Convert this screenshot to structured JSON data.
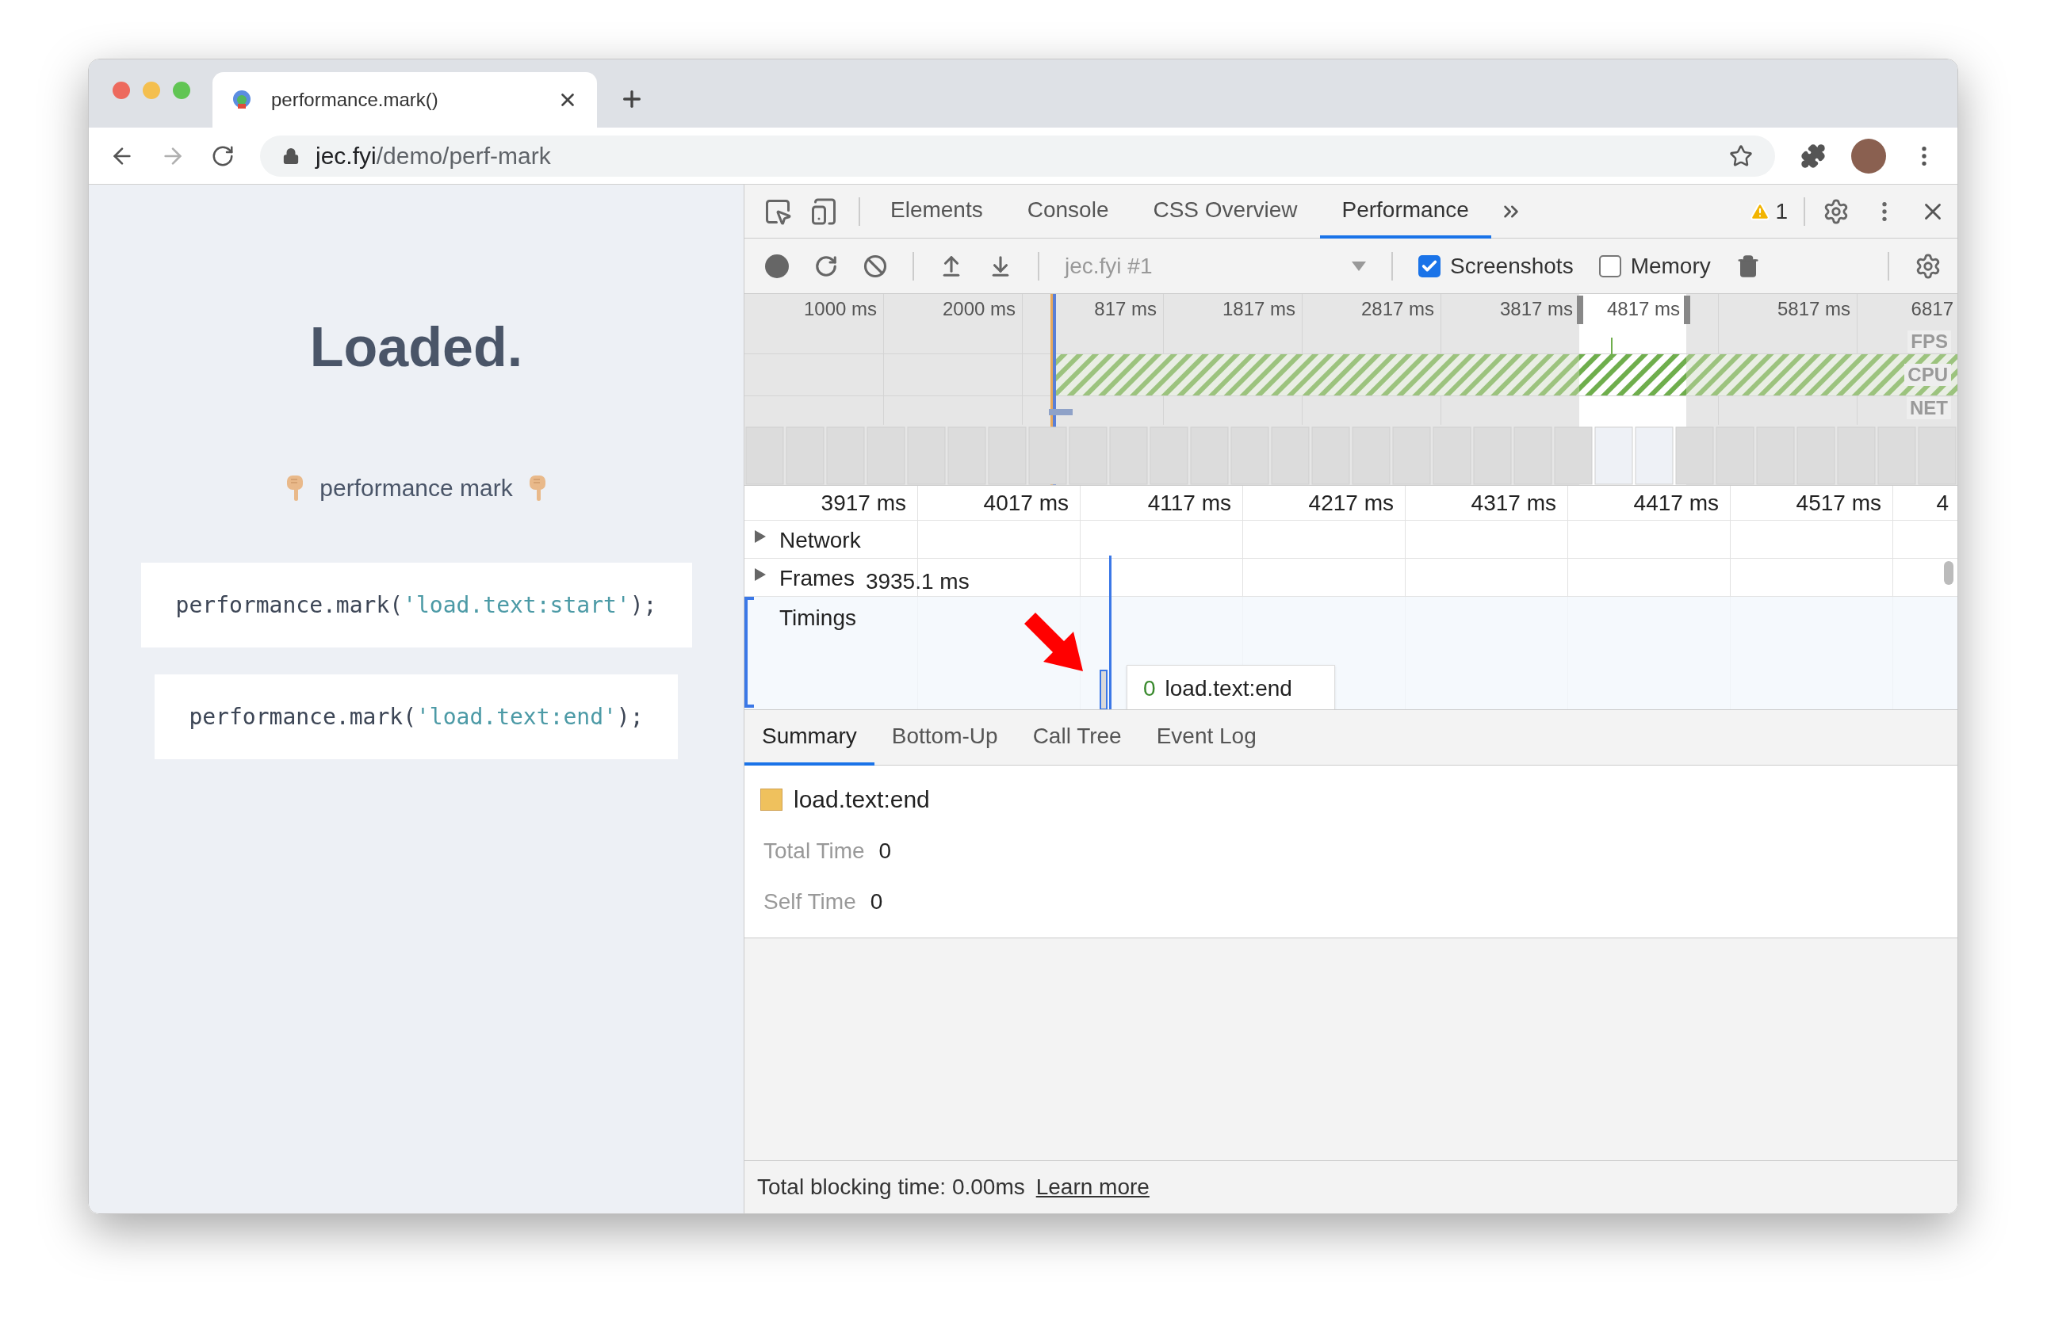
{
  "browser": {
    "tab_title": "performance.mark()",
    "url_host": "jec.fyi",
    "url_path": "/demo/perf-mark"
  },
  "page": {
    "heading": "Loaded.",
    "subheading": "performance mark",
    "code_blocks": [
      {
        "call": "performance.mark(",
        "arg": "'load.text:start'",
        "close": ");"
      },
      {
        "call": "performance.mark(",
        "arg": "'load.text:end'",
        "close": ");"
      }
    ]
  },
  "devtools": {
    "tabs": [
      {
        "label": "Elements",
        "selected": false
      },
      {
        "label": "Console",
        "selected": false
      },
      {
        "label": "CSS Overview",
        "selected": false
      },
      {
        "label": "Performance",
        "selected": true
      }
    ],
    "warning_count": "1",
    "recording_select": "jec.fyi #1",
    "options": [
      {
        "label": "Screenshots",
        "checked": true
      },
      {
        "label": "Memory",
        "checked": false
      }
    ],
    "overview": {
      "ticks": [
        "1000 ms",
        "2000 ms",
        "817 ms",
        "1817 ms",
        "2817 ms",
        "3817 ms",
        "4817 ms",
        "5817 ms",
        "6817"
      ],
      "track_labels": [
        "FPS",
        "CPU",
        "NET"
      ]
    },
    "timeline": {
      "ticks": [
        "3917 ms",
        "4017 ms",
        "4117 ms",
        "4217 ms",
        "4317 ms",
        "4417 ms",
        "4517 ms",
        "4"
      ],
      "tracks": [
        {
          "label": "Network",
          "expandable": true,
          "selected": false
        },
        {
          "label": "Frames",
          "expandable": true,
          "selected": false,
          "value": "3935.1 ms"
        },
        {
          "label": "Timings",
          "expandable": false,
          "selected": true
        }
      ],
      "tooltip": {
        "value": "0",
        "label": "load.text:end"
      }
    },
    "detail_tabs": [
      {
        "label": "Summary",
        "selected": true
      },
      {
        "label": "Bottom-Up",
        "selected": false
      },
      {
        "label": "Call Tree",
        "selected": false
      },
      {
        "label": "Event Log",
        "selected": false
      }
    ],
    "summary": {
      "title": "load.text:end",
      "color": "#efc15d",
      "rows": [
        {
          "label": "Total Time",
          "value": "0"
        },
        {
          "label": "Self Time",
          "value": "0"
        }
      ]
    },
    "footer": {
      "text": "Total blocking time: 0.00ms",
      "link": "Learn more"
    }
  }
}
